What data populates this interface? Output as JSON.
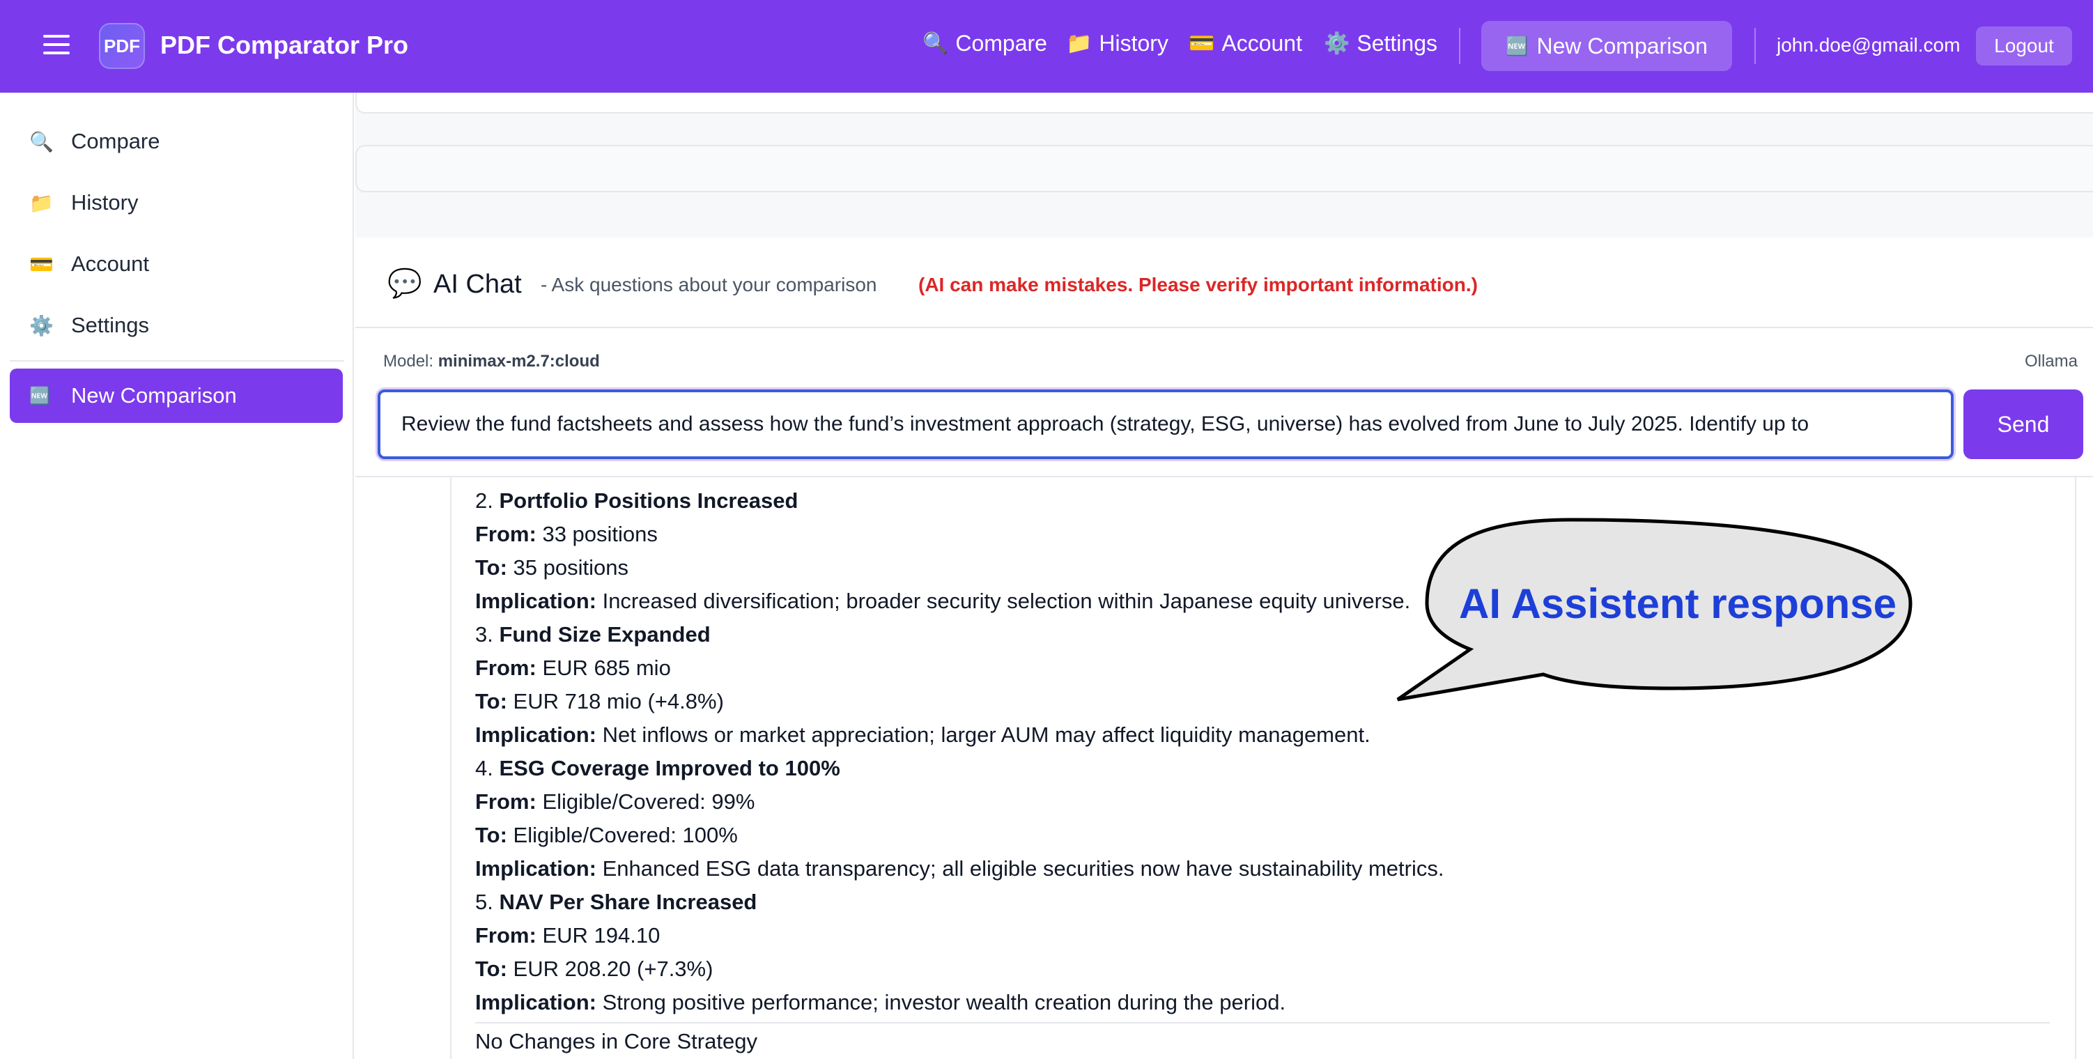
{
  "header": {
    "logo_text": "PDF",
    "app_title": "PDF Comparator Pro",
    "nav": [
      {
        "icon": "magnifier-icon",
        "glyph": "🔍",
        "label": "Compare"
      },
      {
        "icon": "folder-icon",
        "glyph": "📁",
        "label": "History"
      },
      {
        "icon": "credit-card-icon",
        "glyph": "💳",
        "label": "Account"
      },
      {
        "icon": "gear-icon",
        "glyph": "⚙️",
        "label": "Settings"
      }
    ],
    "new_comparison": {
      "icon": "new-badge-icon",
      "glyph": "🆕",
      "label": "New Comparison"
    },
    "user_email": "john.doe@gmail.com",
    "logout_label": "Logout"
  },
  "sidebar": {
    "items": [
      {
        "icon": "magnifier-icon",
        "glyph": "🔍",
        "label": "Compare"
      },
      {
        "icon": "folder-icon",
        "glyph": "📁",
        "label": "History"
      },
      {
        "icon": "credit-card-icon",
        "glyph": "💳",
        "label": "Account"
      },
      {
        "icon": "gear-icon",
        "glyph": "⚙️",
        "label": "Settings"
      }
    ],
    "new_comparison": {
      "icon": "new-badge-icon",
      "glyph": "🆕",
      "label": "New Comparison"
    }
  },
  "chat": {
    "icon_glyph": "💬",
    "title": "AI Chat",
    "subtitle": "- Ask questions about your comparison",
    "warning": "(AI can make mistakes. Please verify important information.)",
    "model_label": "Model:",
    "model_name": "minimax-m2.7:cloud",
    "provider": "Ollama",
    "input_value": "Review the fund factsheets and assess how the fund’s investment approach (strategy, ESG, universe) has evolved from June to July 2025. Identify up to",
    "send_label": "Send"
  },
  "response": {
    "items": [
      {
        "number": "2.",
        "title": "Portfolio Positions Increased",
        "from": "33 positions",
        "to": "35 positions",
        "implication": "Increased diversification; broader security selection within Japanese equity universe."
      },
      {
        "number": "3.",
        "title": "Fund Size Expanded",
        "from": "EUR 685 mio",
        "to": "EUR 718 mio (+4.8%)",
        "implication": "Net inflows or market appreciation; larger AUM may affect liquidity management."
      },
      {
        "number": "4.",
        "title": "ESG Coverage Improved to 100%",
        "from": "Eligible/Covered: 99%",
        "to": "Eligible/Covered: 100%",
        "implication": "Enhanced ESG data transparency; all eligible securities now have sustainability metrics."
      },
      {
        "number": "5.",
        "title": "NAV Per Share Increased",
        "from": "EUR 194.10",
        "to": "EUR 208.20 (+7.3%)",
        "implication": "Strong positive performance; investor wealth creation during the period."
      }
    ],
    "labels": {
      "from": "From:",
      "to": "To:",
      "implication": "Implication:"
    },
    "footer_heading": "No Changes in Core Strategy"
  },
  "annotation": {
    "text": "AI Assistent response",
    "text_color": "#1d3fd8",
    "bubble_fill": "#e5e5e5"
  },
  "colors": {
    "brand": "#7c3aed",
    "warning": "#dc2626"
  }
}
